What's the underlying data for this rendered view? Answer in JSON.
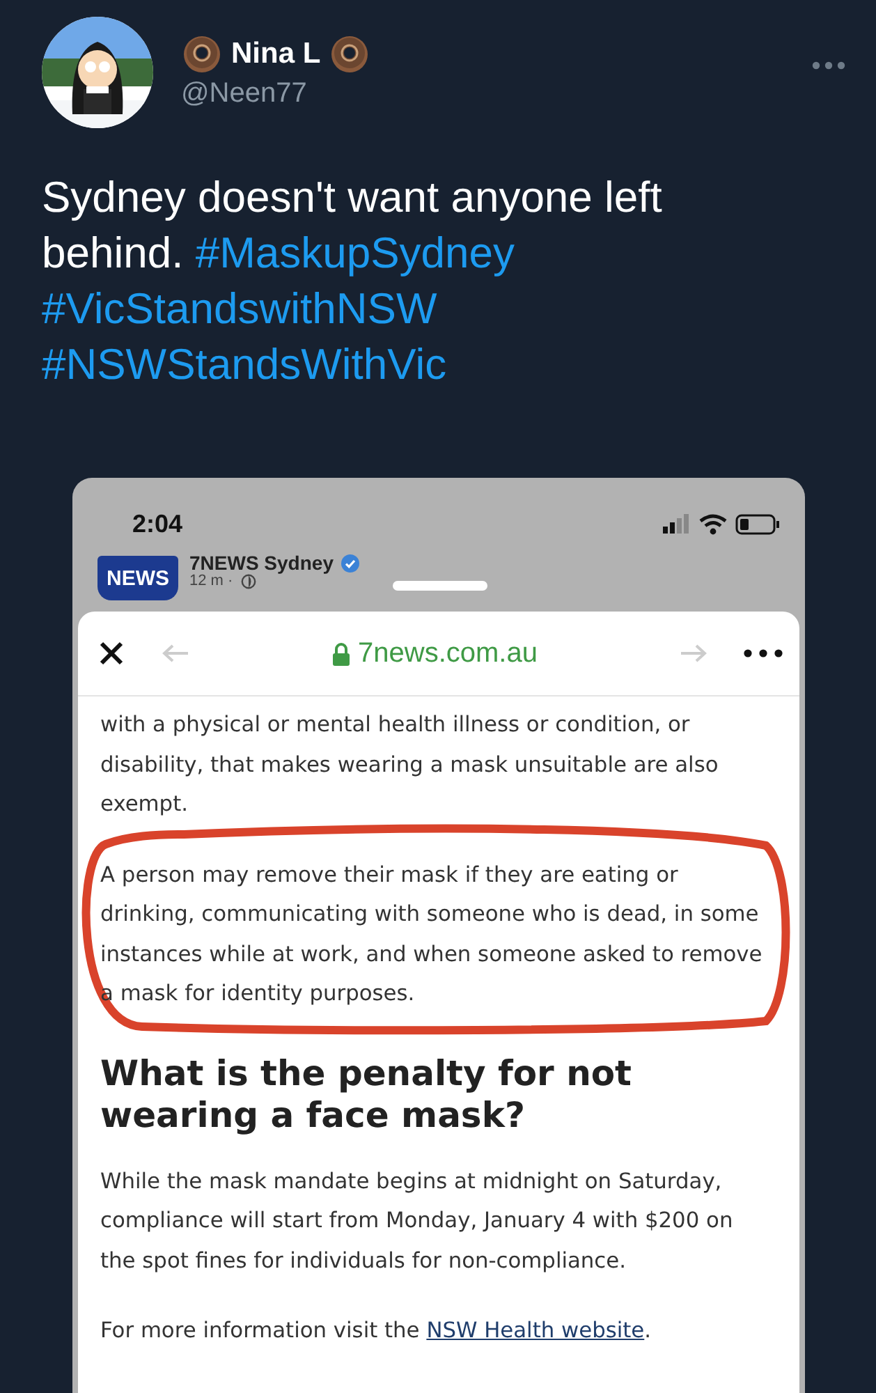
{
  "tweet": {
    "author": {
      "name": "Nina L",
      "handle": "@Neen77"
    },
    "text": "Sydney doesn't want anyone left behind.",
    "hashtags": [
      "#MaskupSydney",
      "#VicStandswithNSW",
      "#NSWStandsWithVic"
    ]
  },
  "screenshot": {
    "status_bar": {
      "time": "2:04"
    },
    "post": {
      "logo_text": "NEWS",
      "page_name": "7NEWS Sydney",
      "time": "12 m ·"
    },
    "browser": {
      "url": "7news.com.au"
    },
    "article": [
      {
        "kind": "paragraph",
        "text": "with a physical or mental health illness or condition, or disability, that makes wearing a mask unsuitable are also exempt.",
        "annotated": false
      },
      {
        "kind": "paragraph",
        "text": "A person may remove their mask if they are eating or drinking, communicating with someone who is dead, in some instances while at work, and when someone asked to remove a mask for identity purposes.",
        "annotated": true
      },
      {
        "kind": "heading",
        "text": "What is the penalty for not wearing a face mask?"
      },
      {
        "kind": "paragraph",
        "text": "While the mask mandate begins at midnight on Saturday, compliance will start from Monday, January 4 with $200 on the spot fines for individuals for non-compliance.",
        "annotated": false
      },
      {
        "kind": "link_paragraph",
        "text": "For more information visit the ",
        "link": "NSW Health website",
        "after": "."
      }
    ]
  }
}
